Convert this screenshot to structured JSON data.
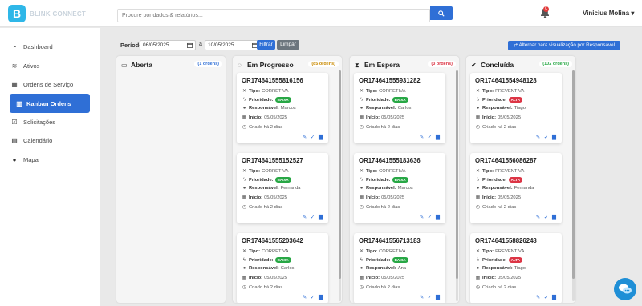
{
  "brand": {
    "mark": "B",
    "name": "BLINK CONNECT",
    "color": "#2fb7e8"
  },
  "search": {
    "placeholder": "Procure por dados & relatórios..."
  },
  "notifications": {
    "count": "0"
  },
  "user": {
    "name": "Vinicius Molina"
  },
  "sidebar": {
    "items": [
      {
        "label": "Dashboard",
        "icon": "gauge-icon"
      },
      {
        "label": "Ativos",
        "icon": "layers-icon"
      },
      {
        "label": "Ordens de Serviço",
        "icon": "table-icon"
      },
      {
        "label": "Kanban Ordens",
        "icon": "kanban-icon",
        "active": true
      },
      {
        "label": "Solicitações",
        "icon": "checkbox-icon"
      },
      {
        "label": "Calendário",
        "icon": "calendar-icon"
      },
      {
        "label": "Mapa",
        "icon": "map-pin-icon"
      }
    ]
  },
  "filters": {
    "periodo_label": "Período:",
    "date_from": "06/05/2025",
    "a_label": "a",
    "date_to": "10/05/2025",
    "filtrar": "Filtrar",
    "limpar": "Limpar",
    "alternar": "Alternar para visualização por Responsável"
  },
  "labels": {
    "tipo": "Tipo:",
    "prioridade": "Prioridade:",
    "responsavel": "Responsável:",
    "inicio": "Início:"
  },
  "colors": {
    "accent": "#2f6fd6",
    "baixa": "#28a745",
    "alta": "#dc3545"
  },
  "columns": [
    {
      "title": "Aberta",
      "count": "(1 ordens)",
      "count_color": "#2f6fd6",
      "icon": "folder-open-icon",
      "cards": []
    },
    {
      "title": "Em Progresso",
      "count": "(85 ordens)",
      "count_color": "#c98a00",
      "icon": "spinner-icon",
      "cards": [
        {
          "id": "OR174641555816156",
          "tipo": "CORRETIVA",
          "prioridade": "BAIXA",
          "responsavel": "Marcos",
          "inicio": "05/05/2025",
          "criado": "Criado há 2 dias"
        },
        {
          "id": "OR174641555152527",
          "tipo": "CORRETIVA",
          "prioridade": "BAIXA",
          "responsavel": "Fernanda",
          "inicio": "05/05/2025",
          "criado": "Criado há 2 dias"
        },
        {
          "id": "OR174641555203642",
          "tipo": "CORRETIVA",
          "prioridade": "BAIXA",
          "responsavel": "Carlos",
          "inicio": "05/05/2025",
          "criado": "Criado há 2 dias"
        }
      ]
    },
    {
      "title": "Em Espera",
      "count": "(3 ordens)",
      "count_color": "#dc3545",
      "icon": "hourglass-icon",
      "cards": [
        {
          "id": "OR174641555931282",
          "tipo": "CORRETIVA",
          "prioridade": "BAIXA",
          "responsavel": "Carlos",
          "inicio": "05/05/2025",
          "criado": "Criado há 2 dias"
        },
        {
          "id": "OR174641555183636",
          "tipo": "CORRETIVA",
          "prioridade": "BAIXA",
          "responsavel": "Marcos",
          "inicio": "05/05/2025",
          "criado": "Criado há 2 dias"
        },
        {
          "id": "OR174641556713183",
          "tipo": "CORRETIVA",
          "prioridade": "BAIXA",
          "responsavel": "Ana",
          "inicio": "05/05/2025",
          "criado": "Criado há 2 dias"
        }
      ]
    },
    {
      "title": "Concluída",
      "count": "(102 ordens)",
      "count_color": "#28a745",
      "icon": "check-circle-icon",
      "cards": [
        {
          "id": "OR174641554948128",
          "tipo": "PREVENTIVA",
          "prioridade": "ALTA",
          "responsavel": "Tiago",
          "inicio": "05/05/2025",
          "criado": "Criado há 2 dias"
        },
        {
          "id": "OR174641556086287",
          "tipo": "PREVENTIVA",
          "prioridade": "ALTA",
          "responsavel": "Fernanda",
          "inicio": "05/05/2025",
          "criado": "Criado há 2 dias"
        },
        {
          "id": "OR174641558826248",
          "tipo": "PREVENTIVA",
          "prioridade": "ALTA",
          "responsavel": "Tiago",
          "inicio": "05/05/2025",
          "criado": "Criado há 2 dias"
        }
      ]
    }
  ]
}
